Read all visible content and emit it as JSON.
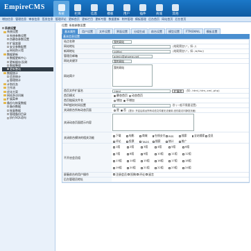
{
  "header": {
    "logo": "EmpireCMS",
    "nav": [
      {
        "label": "系统",
        "icon": "system-icon",
        "active": true
      },
      {
        "label": "栏目",
        "icon": "column-icon"
      },
      {
        "label": "信息",
        "icon": "info-icon"
      },
      {
        "label": "模板",
        "icon": "template-icon"
      },
      {
        "label": "用户",
        "icon": "user-icon"
      },
      {
        "label": "插件",
        "icon": "plugin-icon"
      },
      {
        "label": "商城",
        "icon": "shop-icon"
      },
      {
        "label": "其他",
        "icon": "other-icon"
      }
    ]
  },
  "subnav": [
    "增加信息",
    "管理信息",
    "审核信息",
    "签发信息",
    "管理评论",
    "更新首页",
    "更新栏目",
    "更新专题",
    "数据更新",
    "附件管理",
    "模板管理",
    "后台首页",
    "网站首页",
    "后台首页"
  ],
  "sidebar": {
    "items": [
      {
        "label": "系统设置",
        "level": 0,
        "bold": true
      },
      {
        "label": "系统设置",
        "level": 1
      },
      {
        "label": "系统参数设置",
        "level": 2
      },
      {
        "label": "伪静态参数设置",
        "level": 2
      },
      {
        "label": "扩展变量",
        "level": 2
      },
      {
        "label": "安全参数配置",
        "level": 2
      },
      {
        "label": "网站防火墙",
        "level": 2
      },
      {
        "label": "数据更新",
        "level": 1
      },
      {
        "label": "数据更新中心",
        "level": 2
      },
      {
        "label": "更新缓存/反刷",
        "level": 2
      },
      {
        "label": "数据整理",
        "level": 2
      },
      {
        "label": "更新整站",
        "level": 2,
        "highlight": true
      },
      {
        "label": "数据统计",
        "level": 1
      },
      {
        "label": "信息统计",
        "level": 2
      },
      {
        "label": "管理统计",
        "level": 2
      },
      {
        "label": "计划任务",
        "level": 1
      },
      {
        "label": "工作流",
        "level": 1
      },
      {
        "label": "优化方案",
        "level": 1
      },
      {
        "label": "网站多访问端",
        "level": 1
      },
      {
        "label": "扩展菜单",
        "level": 1
      },
      {
        "label": "备份与恢复数据",
        "level": 1
      },
      {
        "label": "备份数据",
        "level": 2
      },
      {
        "label": "恢复数据",
        "level": 2
      },
      {
        "label": "管理备份目录",
        "level": 2
      },
      {
        "label": "执行SQL语句",
        "level": 2
      }
    ]
  },
  "main": {
    "position": "位置: 系统参数设置",
    "tabs": [
      "基本属性",
      "用户设置",
      "文件设置",
      "界面设置",
      "分组生成",
      "前台设置",
      "模型设置",
      "FTP/EMAIL",
      "模板设置"
    ],
    "panel_title": "基本信息设置",
    "rows": {
      "site_name": {
        "label": "站点名称",
        "value": "我的网站"
      },
      "site_url": {
        "label": "网站地址",
        "value": "/",
        "hint": "(结尾需加\"/\"，如: /)"
      },
      "news_url": {
        "label": "新闻地址",
        "value": "/d/file/",
        "hint": "(结尾需加\"/\"，如: /d/file/)"
      },
      "admin_email": {
        "label": "管理员邮箱",
        "value": "admin@phome.net"
      },
      "site_keywords": {
        "label": "网站关键字",
        "value": "我的网站"
      },
      "site_intro": {
        "label": "网站简介",
        "value": "我的网站"
      },
      "index_ext": {
        "label": "首页文件扩展名",
        "value": ".html",
        "btn": "扩展名",
        "hint": "(如: .html,.htm,.xml,.php)"
      },
      "index_mode": {
        "label": "首页模式",
        "options": [
          "静态首页",
          "动态首页"
        ],
        "selected": 0
      },
      "index_close": {
        "label": "首页链接文件名",
        "options": [
          "增加",
          "不增加"
        ],
        "selected": 1
      },
      "php_time": {
        "label": "PHP超时时间设置",
        "value": "0",
        "hint": "秒 (一般不需要设置)"
      },
      "close_site": {
        "label": "关闭前台所有动态页面",
        "options": [
          "是",
          "否"
        ],
        "selected": 1,
        "hint": "(提示: 开启后前台所有动态文件都无法使用,但仍能访问静态页面)"
      },
      "close_msg": {
        "label": "关闭动态页面提示内容"
      },
      "close_modules": {
        "label": "关闭前台模块的相关功能",
        "modules": [
          "下载",
          "电影",
          "商城",
          "在线支付",
          "RSS",
          "搜索",
          "全站搜索",
          "会员",
          "评论",
          "投票",
          "TAGS",
          "搜索",
          "统计",
          "推广"
        ]
      },
      "user_groups": {
        "label": "不开启会员组",
        "groups": [
          "1组",
          "2组",
          "3组",
          "4组",
          "5组",
          "6组",
          "7组",
          "8组",
          "9组",
          "10组",
          "11组",
          "12组",
          "13组",
          "14组",
          "15组",
          "16组",
          "17组",
          "18组",
          "19组",
          "20组",
          "21组",
          "22组",
          "23组",
          "24组"
        ]
      },
      "order": {
        "label": "屏蔽前台的用户操作",
        "options": [
          "注册会员",
          "投稿",
          "评论",
          "留言"
        ]
      },
      "contact": {
        "label": "后台管理员地址"
      }
    }
  }
}
